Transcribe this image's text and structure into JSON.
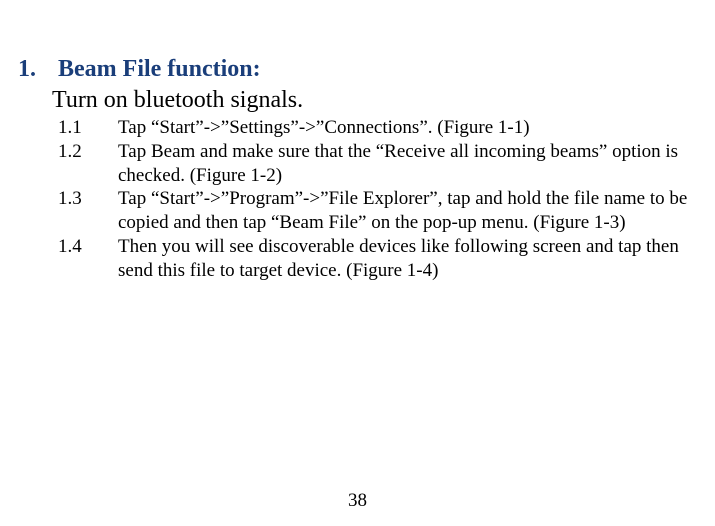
{
  "heading": {
    "number": "1.",
    "title": "Beam File function:"
  },
  "intro": "Turn on bluetooth signals.",
  "steps": [
    {
      "num": "1.1",
      "text": "Tap “Start”->”Settings”->”Connections”. (Figure 1-1)"
    },
    {
      "num": "1.2",
      "text": "Tap Beam and make sure that the “Receive all incoming beams” option is checked. (Figure 1-2)"
    },
    {
      "num": "1.3",
      "text": "Tap “Start”->”Program”->”File Explorer”, tap and hold the file name to be copied and then tap “Beam File” on the pop-up menu. (Figure 1-3)"
    },
    {
      "num": "1.4",
      "text": "Then you will see discoverable devices like following screen and tap then send this file to target device. (Figure 1-4)"
    }
  ],
  "page_number": "38"
}
